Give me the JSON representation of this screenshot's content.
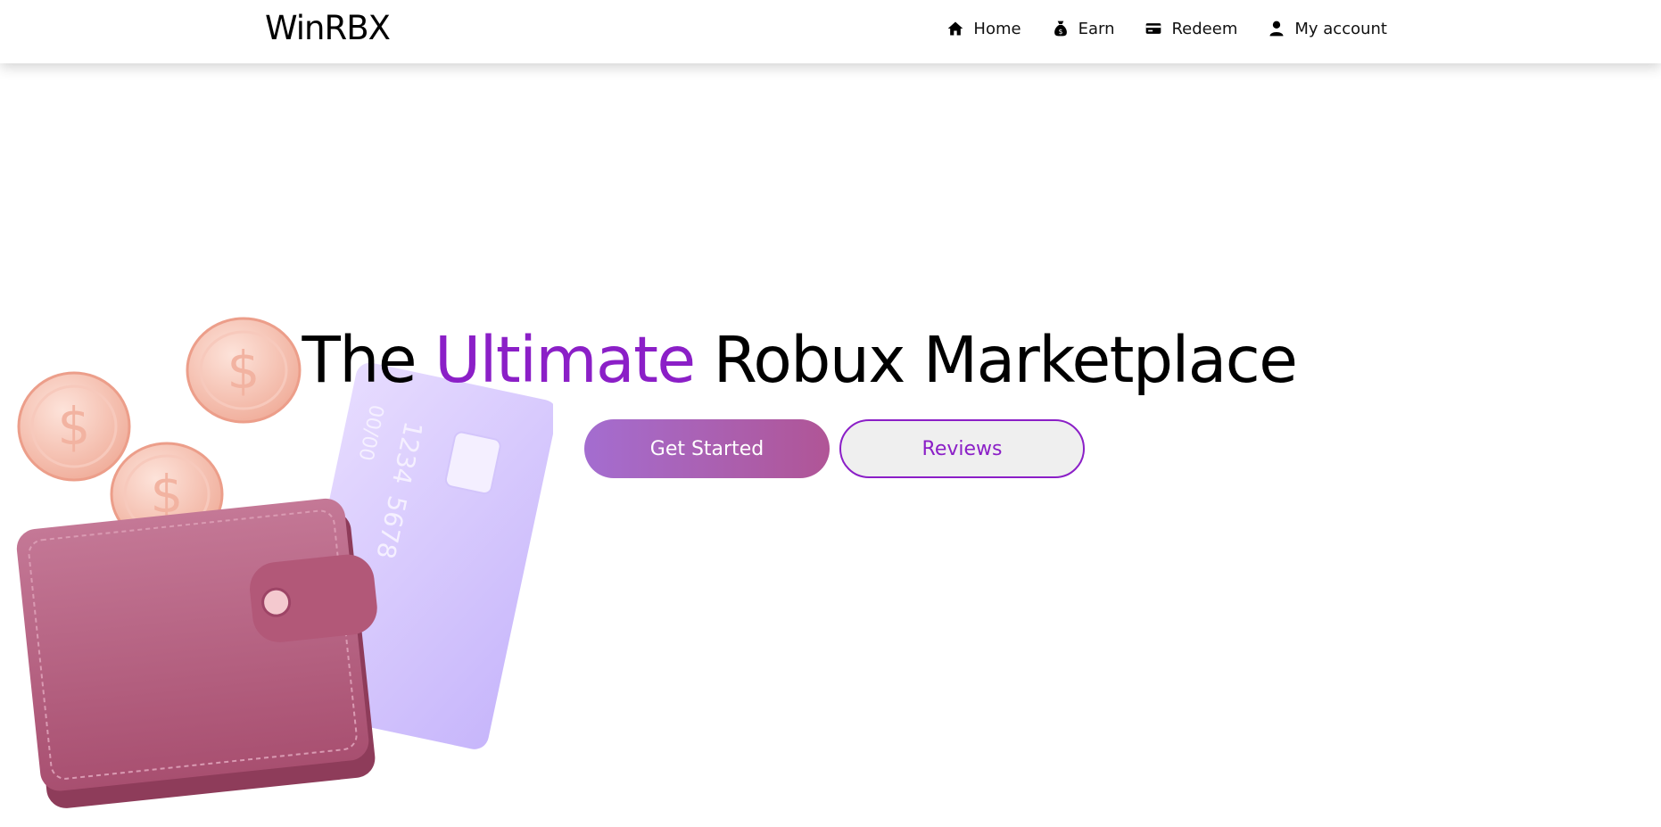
{
  "brand": {
    "name": "WinRBX"
  },
  "nav": {
    "items": [
      {
        "label": "Home",
        "icon": "home-icon"
      },
      {
        "label": "Earn",
        "icon": "money-bag-icon"
      },
      {
        "label": "Redeem",
        "icon": "credit-card-icon"
      },
      {
        "label": "My account",
        "icon": "user-icon"
      }
    ]
  },
  "hero": {
    "title_before": "The",
    "title_accent": "Ultimate",
    "title_after": "Robux Marketplace",
    "primary_button": "Get Started",
    "secondary_button": "Reviews"
  },
  "illustration": {
    "card_number_line1": "1234",
    "card_number_line2": "5678",
    "card_expiry": "00/00",
    "coin_symbol": "$"
  },
  "colors": {
    "accent": "#8b1fc7",
    "button_gradient_start": "#a46dd0",
    "button_gradient_end": "#b05596",
    "wallet": "#b7607d",
    "card": "#d9cdfb",
    "coin": "#f6c3b4"
  }
}
